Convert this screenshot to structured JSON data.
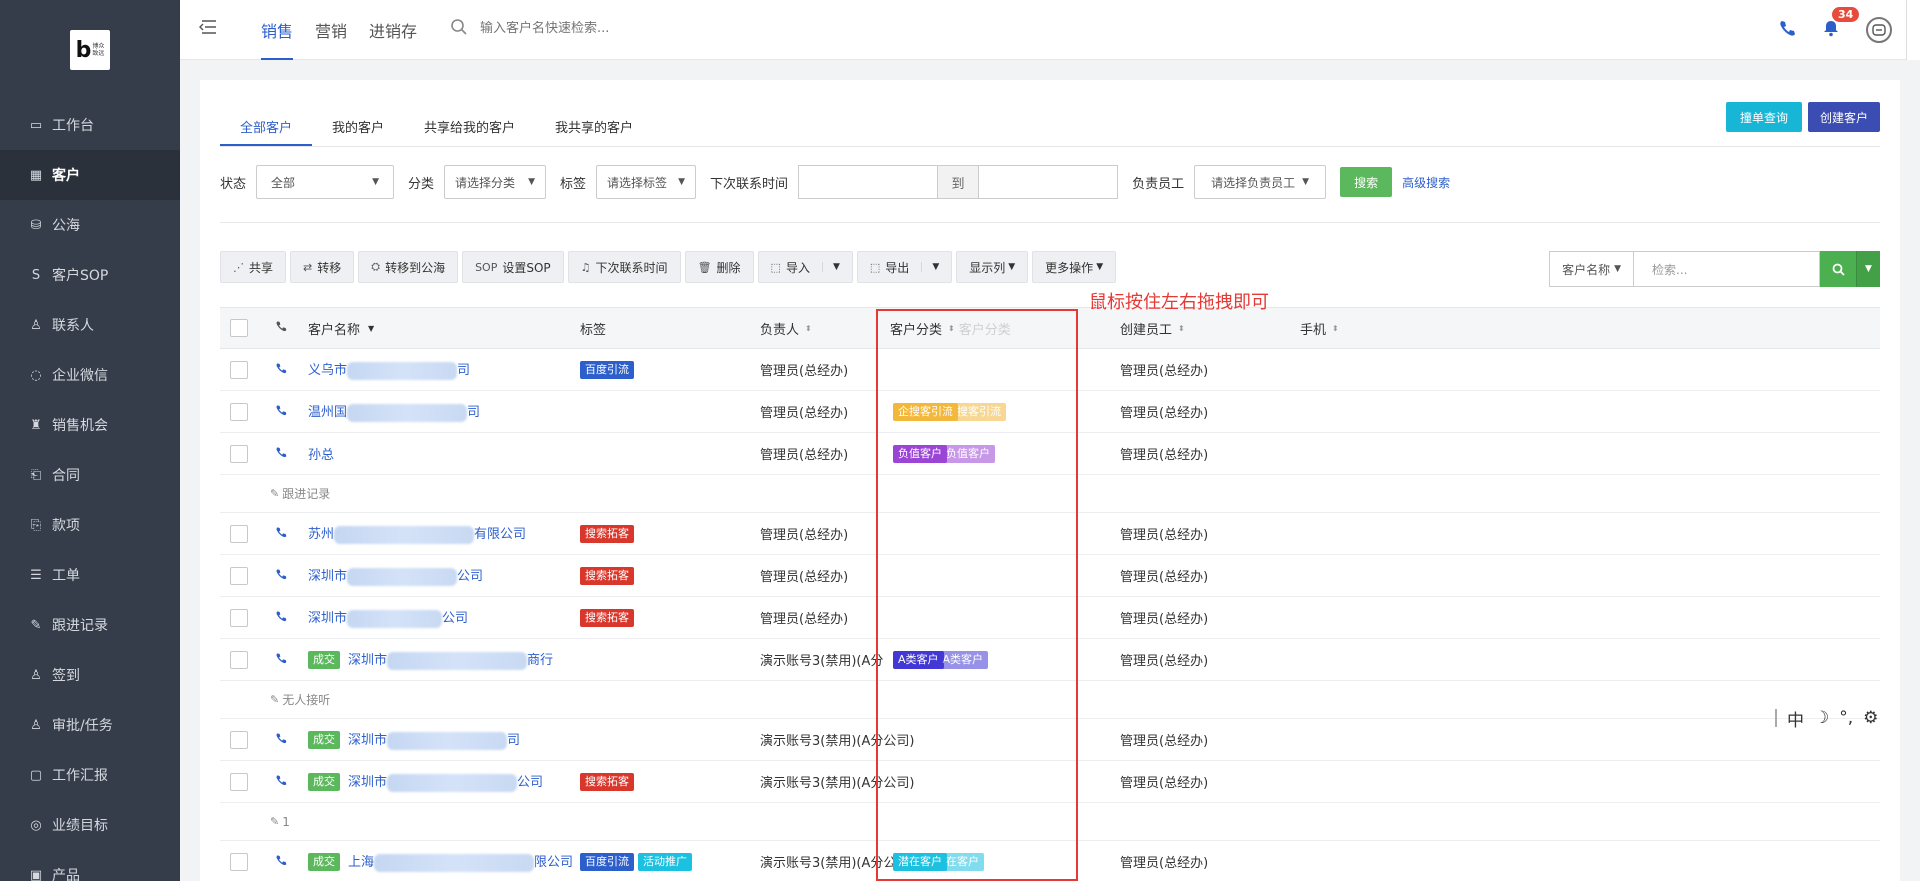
{
  "logo": {
    "letter": "b",
    "text_line1": "博众",
    "text_line2": "致远"
  },
  "sidebar": {
    "items": [
      {
        "label": "工作台",
        "icon": "monitor-icon",
        "active": false
      },
      {
        "label": "客户",
        "icon": "building-icon",
        "active": true
      },
      {
        "label": "公海",
        "icon": "bucket-icon",
        "active": false
      },
      {
        "label": "客户SOP",
        "icon": "sop-icon",
        "active": false
      },
      {
        "label": "联系人",
        "icon": "person-icon",
        "active": false
      },
      {
        "label": "企业微信",
        "icon": "chat-icon",
        "active": false
      },
      {
        "label": "销售机会",
        "icon": "money-bag-icon",
        "active": false
      },
      {
        "label": "合同",
        "icon": "contract-icon",
        "active": false
      },
      {
        "label": "款项",
        "icon": "payment-icon",
        "active": false
      },
      {
        "label": "工单",
        "icon": "ticket-icon",
        "active": false
      },
      {
        "label": "跟进记录",
        "icon": "edit-icon",
        "active": false
      },
      {
        "label": "签到",
        "icon": "location-person-icon",
        "active": false
      },
      {
        "label": "审批/任务",
        "icon": "approval-icon",
        "active": false
      },
      {
        "label": "工作汇报",
        "icon": "report-icon",
        "active": false
      },
      {
        "label": "业绩目标",
        "icon": "target-icon",
        "active": false
      },
      {
        "label": "产品",
        "icon": "product-icon",
        "active": false
      }
    ]
  },
  "topbar": {
    "tabs": [
      "销售",
      "营销",
      "进销存"
    ],
    "active_tab": "销售",
    "search_placeholder": "输入客户名快速检索...",
    "notification_count": "34"
  },
  "sub_tabs": [
    "全部客户",
    "我的客户",
    "共享给我的客户",
    "我共享的客户"
  ],
  "active_sub_tab": "全部客户",
  "actions": {
    "lookup": "撞单查询",
    "create": "创建客户"
  },
  "filters": {
    "status_label": "状态",
    "status_value": "全部",
    "category_label": "分类",
    "category_value": "请选择分类",
    "tag_label": "标签",
    "tag_value": "请选择标签",
    "next_contact_label": "下次联系时间",
    "to_label": "到",
    "owner_label": "负责员工",
    "owner_value": "请选择负责员工",
    "search_btn": "搜索",
    "advanced": "高级搜索"
  },
  "toolbar": {
    "share": "共享",
    "transfer": "转移",
    "to_pool": "转移到公海",
    "set_sop": "设置SOP",
    "next_contact": "下次联系时间",
    "delete": "删除",
    "import": "导入",
    "export": "导出",
    "columns": "显示列",
    "more": "更多操作"
  },
  "right_search": {
    "field": "客户名称",
    "placeholder": "检索..."
  },
  "table": {
    "headers": {
      "name": "客户名称",
      "tags": "标签",
      "owner": "负责人",
      "category": "客户分类",
      "category_ghost": "客户分类",
      "creator": "创建员工",
      "mobile": "手机"
    },
    "rows": [
      {
        "deal": "",
        "name_a": "义乌市",
        "name_b": "司",
        "tags": [
          {
            "text": "百度引流",
            "color": "blue"
          }
        ],
        "owner": "管理员(总经办)",
        "cat": "",
        "cat_color": "",
        "creator": "管理员(总经办)",
        "sub": ""
      },
      {
        "deal": "",
        "name_a": "温州国",
        "name_b": "司",
        "tags": [],
        "owner": "管理员(总经办)",
        "cat": "企搜客引流",
        "ghost": "搜客引流",
        "cat_color": "#f3b73a",
        "creator": "管理员(总经办)",
        "sub": ""
      },
      {
        "deal": "",
        "name_a": "孙总",
        "name_b": "",
        "tags": [],
        "owner": "管理员(总经办)",
        "cat": "负值客户",
        "ghost": "负值客户",
        "cat_color": "#9b45d6",
        "creator": "管理员(总经办)",
        "sub": "跟进记录"
      },
      {
        "deal": "",
        "name_a": "苏州",
        "name_b": "有限公司",
        "tags": [
          {
            "text": "搜索拓客",
            "color": "red"
          }
        ],
        "owner": "管理员(总经办)",
        "cat": "",
        "cat_color": "",
        "creator": "管理员(总经办)",
        "sub": ""
      },
      {
        "deal": "",
        "name_a": "深圳市",
        "name_b": "公司",
        "tags": [
          {
            "text": "搜索拓客",
            "color": "red"
          }
        ],
        "owner": "管理员(总经办)",
        "cat": "",
        "cat_color": "",
        "creator": "管理员(总经办)",
        "sub": ""
      },
      {
        "deal": "",
        "name_a": "深圳市",
        "name_b": "公司",
        "tags": [
          {
            "text": "搜索拓客",
            "color": "red"
          }
        ],
        "owner": "管理员(总经办)",
        "cat": "",
        "cat_color": "",
        "creator": "管理员(总经办)",
        "sub": ""
      },
      {
        "deal": "成交",
        "name_a": "深圳市",
        "name_b": "商行",
        "tags": [],
        "owner": "演示账号3(禁用)(A分",
        "cat": "A类客户",
        "ghost": "A类客户",
        "cat_color": "#4338d6",
        "creator": "管理员(总经办)",
        "sub": "无人接听"
      },
      {
        "deal": "成交",
        "name_a": "深圳市",
        "name_b": "司",
        "tags": [],
        "owner": "演示账号3(禁用)(A分公司)",
        "cat": "",
        "cat_color": "",
        "creator": "管理员(总经办)",
        "sub": ""
      },
      {
        "deal": "成交",
        "name_a": "深圳市",
        "name_b": "公司",
        "tags": [
          {
            "text": "搜索拓客",
            "color": "red"
          }
        ],
        "owner": "演示账号3(禁用)(A分公司)",
        "cat": "",
        "cat_color": "",
        "creator": "管理员(总经办)",
        "sub": "1"
      },
      {
        "deal": "成交",
        "name_a": "上海",
        "name_b": "限公司",
        "tags": [
          {
            "text": "百度引流",
            "color": "blue"
          },
          {
            "text": "活动推广",
            "color": "cyan"
          }
        ],
        "owner": "演示账号3(禁用)(A分公司)",
        "cat": "潜在客户",
        "ghost": "在客户",
        "cat_color": "#1cc0e0",
        "creator": "管理员(总经办)",
        "sub": ""
      }
    ]
  },
  "annotation": "鼠标按住左右拖拽即可",
  "ime": {
    "lang": "中",
    "moon": "☽",
    "punct": "°,",
    "gear": "⚙"
  },
  "colors": {
    "sidebar": "#363d4a",
    "accent": "#2d5fcc",
    "highlight": "#e53935"
  }
}
